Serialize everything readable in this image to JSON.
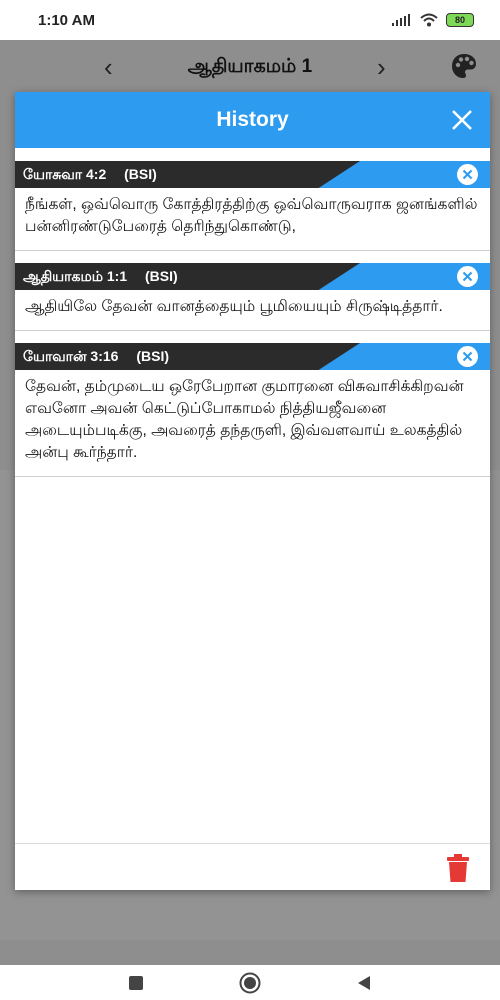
{
  "status_bar": {
    "time": "1:10 AM",
    "battery": "80"
  },
  "app_bar": {
    "title": "ஆதியாகமம் 1",
    "prev_icon": "chevron-left-icon",
    "next_icon": "chevron-right-icon",
    "theme_icon": "palette-icon"
  },
  "dialog": {
    "title": "History",
    "close_icon": "close-icon",
    "entries": [
      {
        "reference": "யோசுவா 4:2",
        "version": "(BSI)",
        "text": "நீங்கள், ஒவ்வொரு கோத்திரத்திற்கு ஒவ்வொருவராக ஜனங்களில் பன்னிரண்டுபேரைத் தெரிந்துகொண்டு,"
      },
      {
        "reference": "ஆதியாகமம் 1:1",
        "version": "(BSI)",
        "text": "ஆதியிலே தேவன் வானத்தையும் பூமியையும் சிருஷ்டித்தார்."
      },
      {
        "reference": "யோவான் 3:16",
        "version": "(BSI)",
        "text": "தேவன், தம்முடைய ஒரேபேறான குமாரனை விசுவாசிக்கிறவன் எவனோ அவன் கெட்டுப்போகாமல் நித்தியஜீவனை அடையும்படிக்கு, அவரைத் தந்தருளி, இவ்வளவாய் உலகத்தில் அன்பு கூர்ந்தார்."
      }
    ],
    "footer": {
      "delete_icon": "trash-icon"
    }
  },
  "colors": {
    "accent": "#2c9bf0",
    "header_dark": "#2b2b2b",
    "delete": "#e53935",
    "scrim": "#8e8e8e"
  },
  "nav_bar": {
    "recents_icon": "square-icon",
    "home_icon": "circle-icon",
    "back_icon": "triangle-back-icon"
  }
}
